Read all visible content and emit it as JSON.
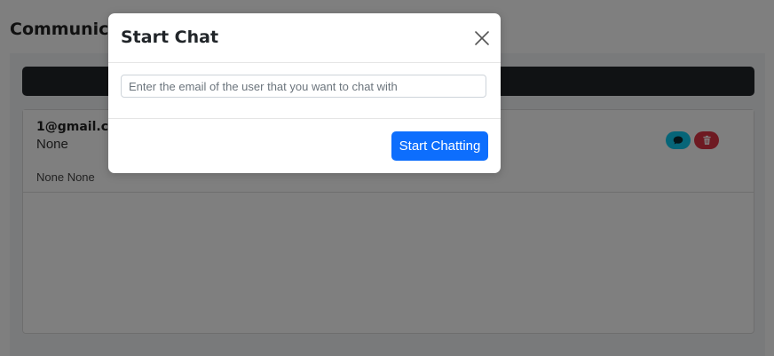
{
  "page": {
    "title": "Communications"
  },
  "chat_list": {
    "items": [
      {
        "email": "1@gmail.com",
        "name": "None",
        "subtitle": "None None",
        "actions": [
          {
            "icon": "chat-bubble-icon",
            "color": "#0dcaf0"
          },
          {
            "icon": "trash-icon",
            "color": "#dc3545"
          }
        ]
      }
    ]
  },
  "modal": {
    "title": "Start Chat",
    "close_icon": "close-icon",
    "input_placeholder": "Enter the email of the user that you want to chat with",
    "input_value": "",
    "submit_label": "Start Chatting"
  },
  "colors": {
    "primary": "#0d6efd",
    "info": "#0dcaf0",
    "danger": "#dc3545",
    "dark": "#212529",
    "backdrop": "rgba(0,0,0,0.5)"
  }
}
